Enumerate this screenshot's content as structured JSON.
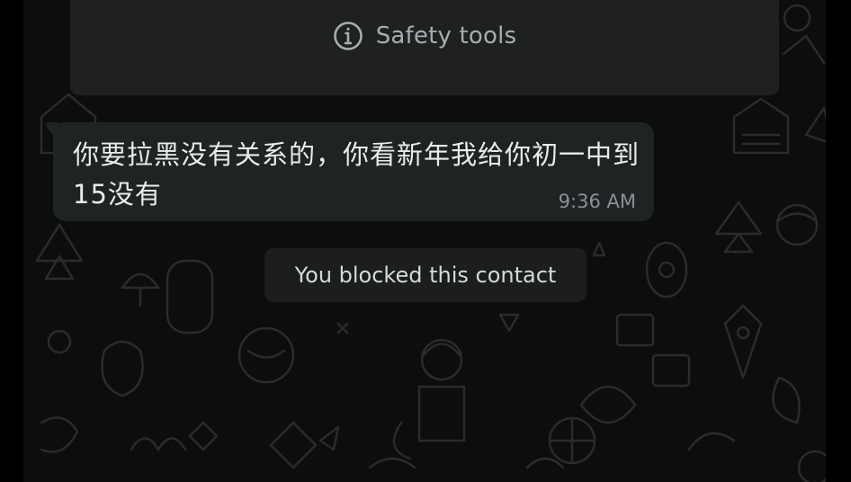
{
  "safety": {
    "label": "Safety tools",
    "icon": "info-icon"
  },
  "message": {
    "text": "你要拉黑没有关系的，你看新年我给你初一中到15没有",
    "time": "9:36 AM"
  },
  "system": {
    "blocked_text": "You blocked this contact"
  },
  "colors": {
    "chat_background": "#0c0d0d",
    "bubble": "#202323",
    "card": "#1f2121"
  }
}
